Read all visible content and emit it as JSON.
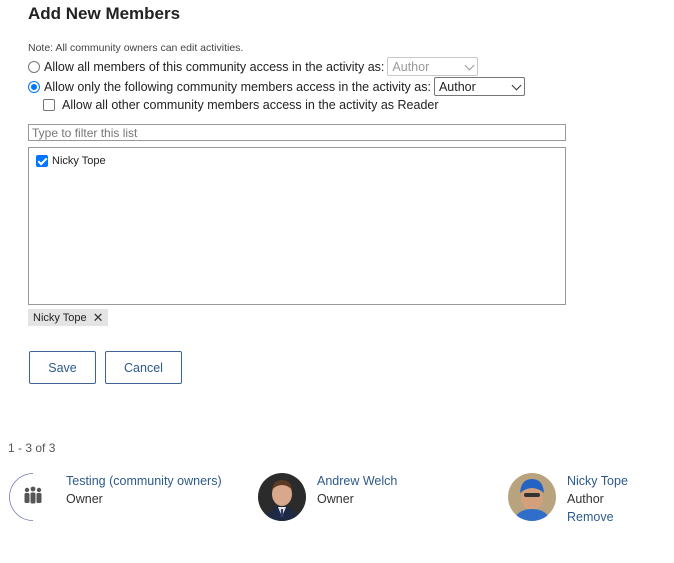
{
  "form": {
    "title": "Add New Members",
    "note": "Note: All community owners can edit activities.",
    "option_all_label": "Allow all members of this community access in the activity as:",
    "option_all_role": "Author",
    "option_following_label": "Allow only the following community members access in the activity as:",
    "option_following_role": "Author",
    "reader_label": "Allow all other community members access in the activity as Reader",
    "filter_placeholder": "Type to filter this list",
    "list_items": [
      {
        "name": "Nicky Tope",
        "checked": true
      }
    ],
    "selected_tag": "Nicky Tope",
    "save_label": "Save",
    "cancel_label": "Cancel"
  },
  "members": {
    "count_text": "1 - 3 of 3",
    "items": [
      {
        "name": "Testing (community owners)",
        "role": "Owner",
        "avatar": "group-icon"
      },
      {
        "name": "Andrew Welch",
        "role": "Owner",
        "avatar": "photo"
      },
      {
        "name": "Nicky Tope",
        "role": "Author",
        "action": "Remove",
        "avatar": "photo"
      }
    ]
  },
  "colors": {
    "accent": "#0075ff",
    "link": "#2d5a8c",
    "button_border": "#3c6494"
  }
}
